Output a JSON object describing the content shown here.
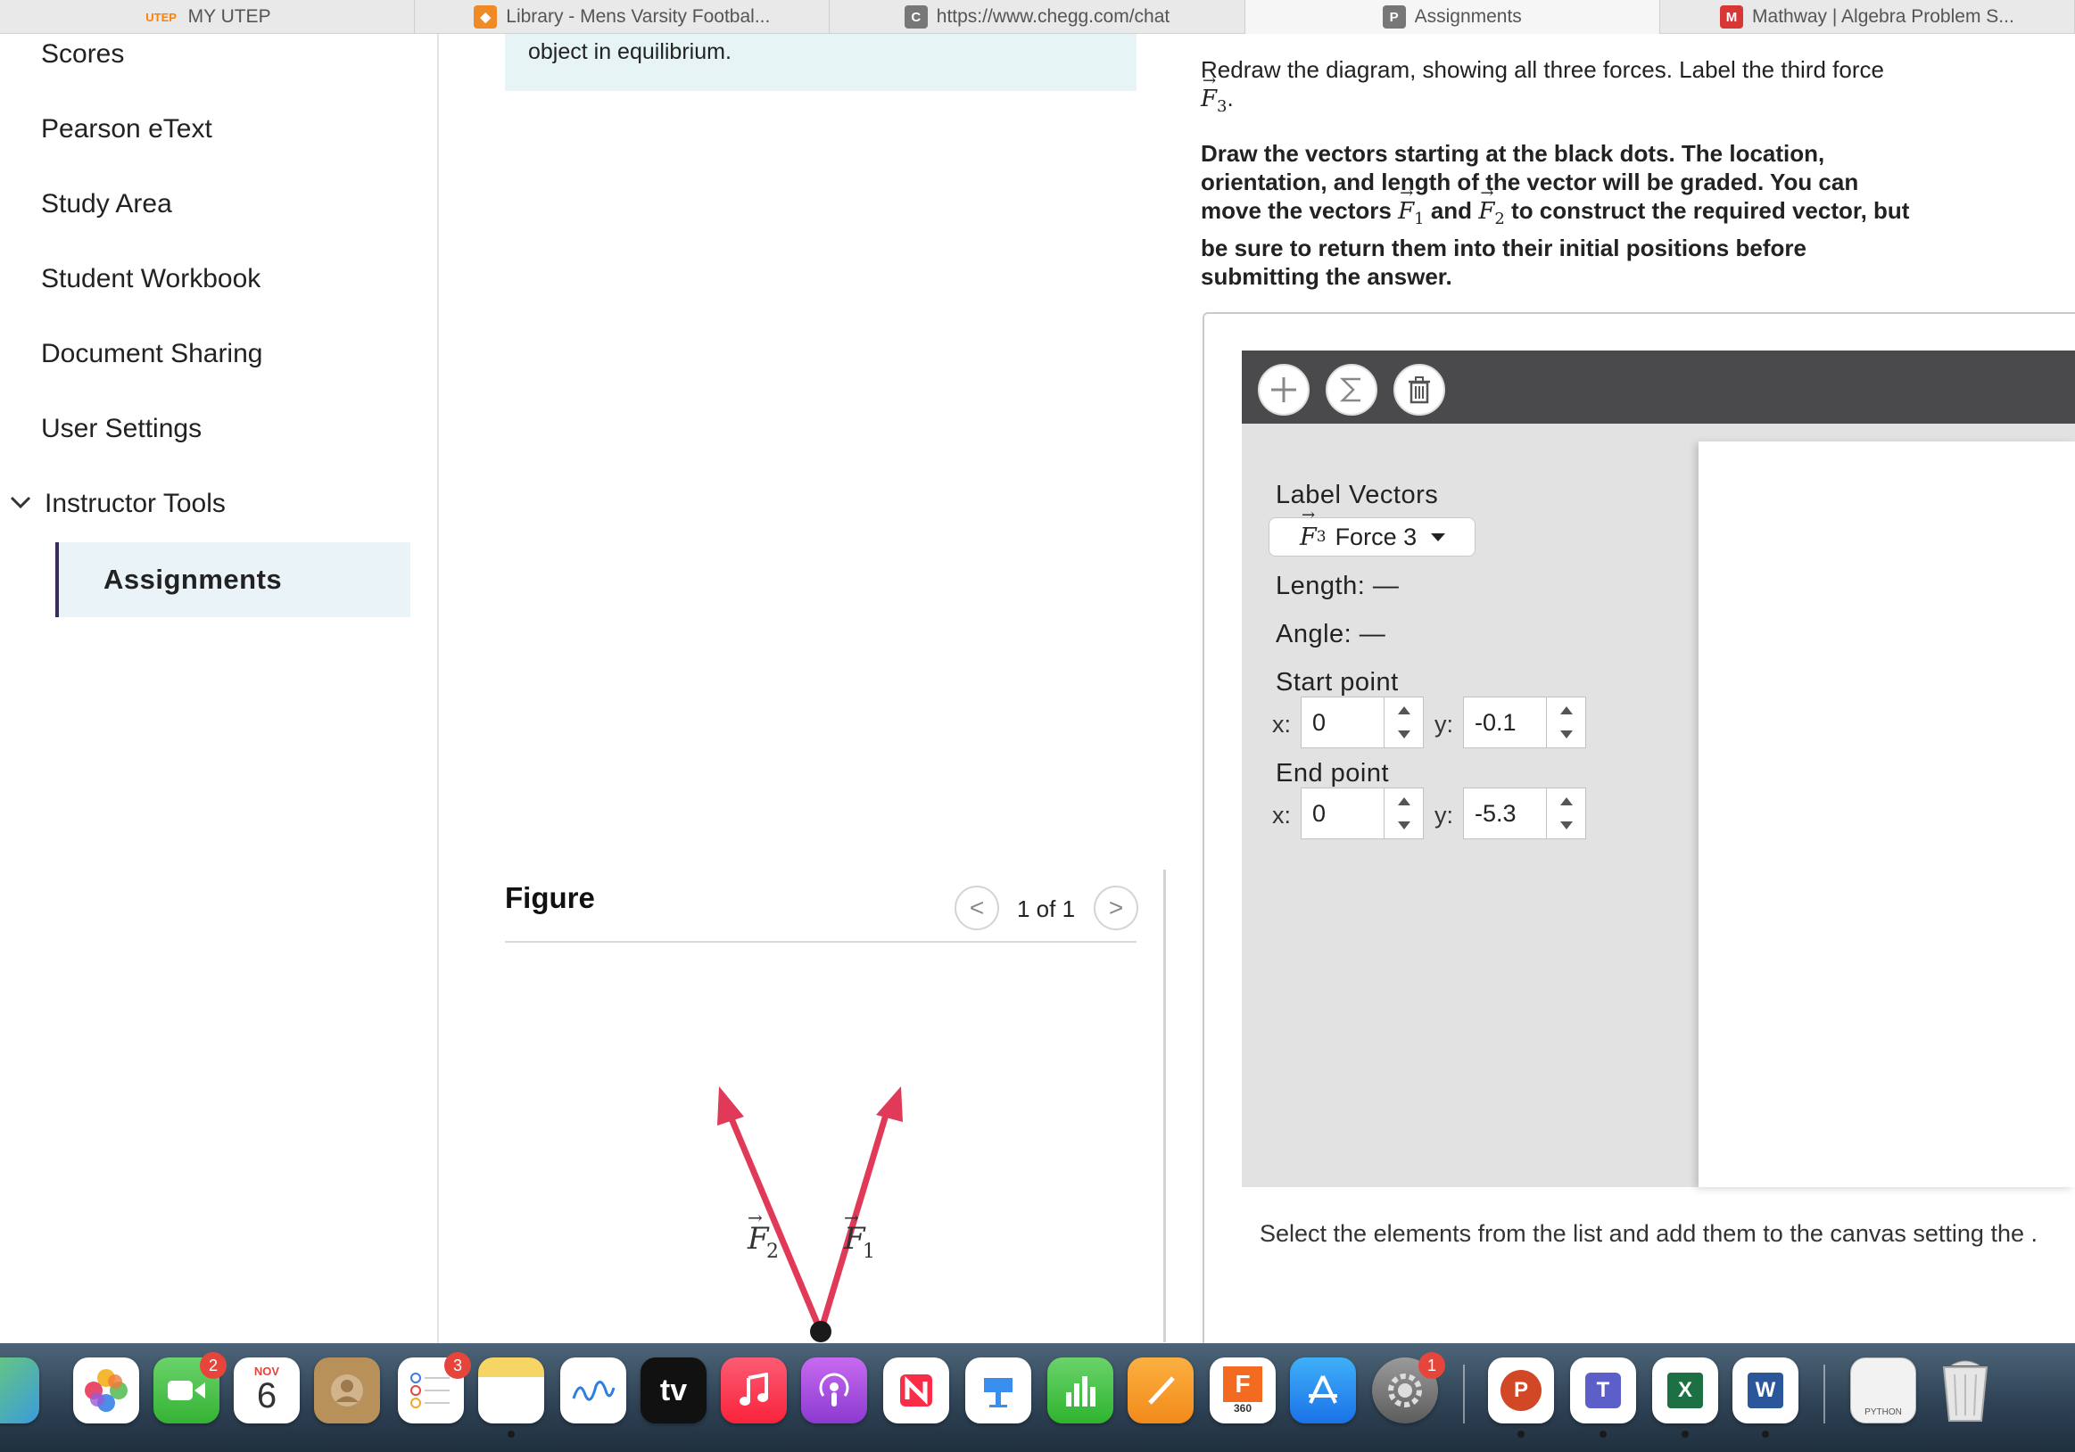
{
  "browser": {
    "tabs": [
      {
        "label": "MY UTEP",
        "icon_text": "UTEP",
        "icon_color": "#ff8200"
      },
      {
        "label": "Library - Mens Varsity Footbal...",
        "icon_text": "◆",
        "icon_color": "#f08a24"
      },
      {
        "label": "https://www.chegg.com/chat",
        "icon_text": "C",
        "icon_color": "#777777"
      },
      {
        "label": "Assignments",
        "icon_text": "P",
        "icon_color": "#777777"
      },
      {
        "label": "Mathway | Algebra Problem S...",
        "icon_text": "M",
        "icon_color": "#d93636"
      }
    ]
  },
  "sidebar": {
    "items": [
      {
        "label": "Scores"
      },
      {
        "label": "Pearson eText"
      },
      {
        "label": "Study Area"
      },
      {
        "label": "Student Workbook"
      },
      {
        "label": "Document Sharing"
      },
      {
        "label": "User Settings"
      }
    ],
    "section": {
      "label": "Instructor Tools",
      "expanded": true
    },
    "active_item": {
      "label": "Assignments"
    }
  },
  "problem": {
    "hint_text": "object in equilibrium."
  },
  "figure": {
    "title": "Figure",
    "page_indicator": "1 of 1",
    "prev_label": "<",
    "next_label": ">",
    "vector_labels": [
      "F",
      "2",
      "F",
      "1"
    ],
    "vector_color": "#e03a58"
  },
  "instructions": {
    "line1": "Redraw the diagram, showing all three forces. Label the third force",
    "line1_vec": "F",
    "line1_sub": "3",
    "line1_end": ".",
    "bold1": "Draw the vectors starting at the black dots. The location, orientation, and length of the vector will be graded. You can move the vectors",
    "bold_vec1": "F",
    "bold_sub1": "1",
    "bold_and": "and",
    "bold_vec2": "F",
    "bold_sub2": "2",
    "bold2": "to construct the required vector, but be sure to return them into their initial positions before submitting the answer."
  },
  "tool": {
    "add_icon": "plus-icon",
    "sum_icon": "sigma-icon",
    "delete_icon": "trash-icon",
    "label_vectors": "Label Vectors",
    "selected_vector_symbol": "F",
    "selected_vector_sub": "3",
    "selected_vector_name": "Force 3",
    "length_label": "Length:",
    "length_value": "—",
    "angle_label": "Angle:",
    "angle_value": "—",
    "start_label": "Start point",
    "end_label": "End point",
    "x_label": "x:",
    "y_label": "y:",
    "start_x": "0",
    "start_y": "-0.1",
    "end_x": "0",
    "end_y": "-5.3",
    "select_note": "Select the elements from the list and add them to the canvas setting the ."
  },
  "dock": {
    "calendar_month": "NOV",
    "calendar_day": "6",
    "facetime_badge": "2",
    "reminders_badge": "3",
    "settings_badge": "1",
    "tv_label": "tv",
    "fusion_label": "F",
    "fusion_sub": "360",
    "powerpoint_label": "P",
    "teams_label": "T",
    "excel_label": "X",
    "word_label": "W",
    "python_label": "PYTHON"
  }
}
